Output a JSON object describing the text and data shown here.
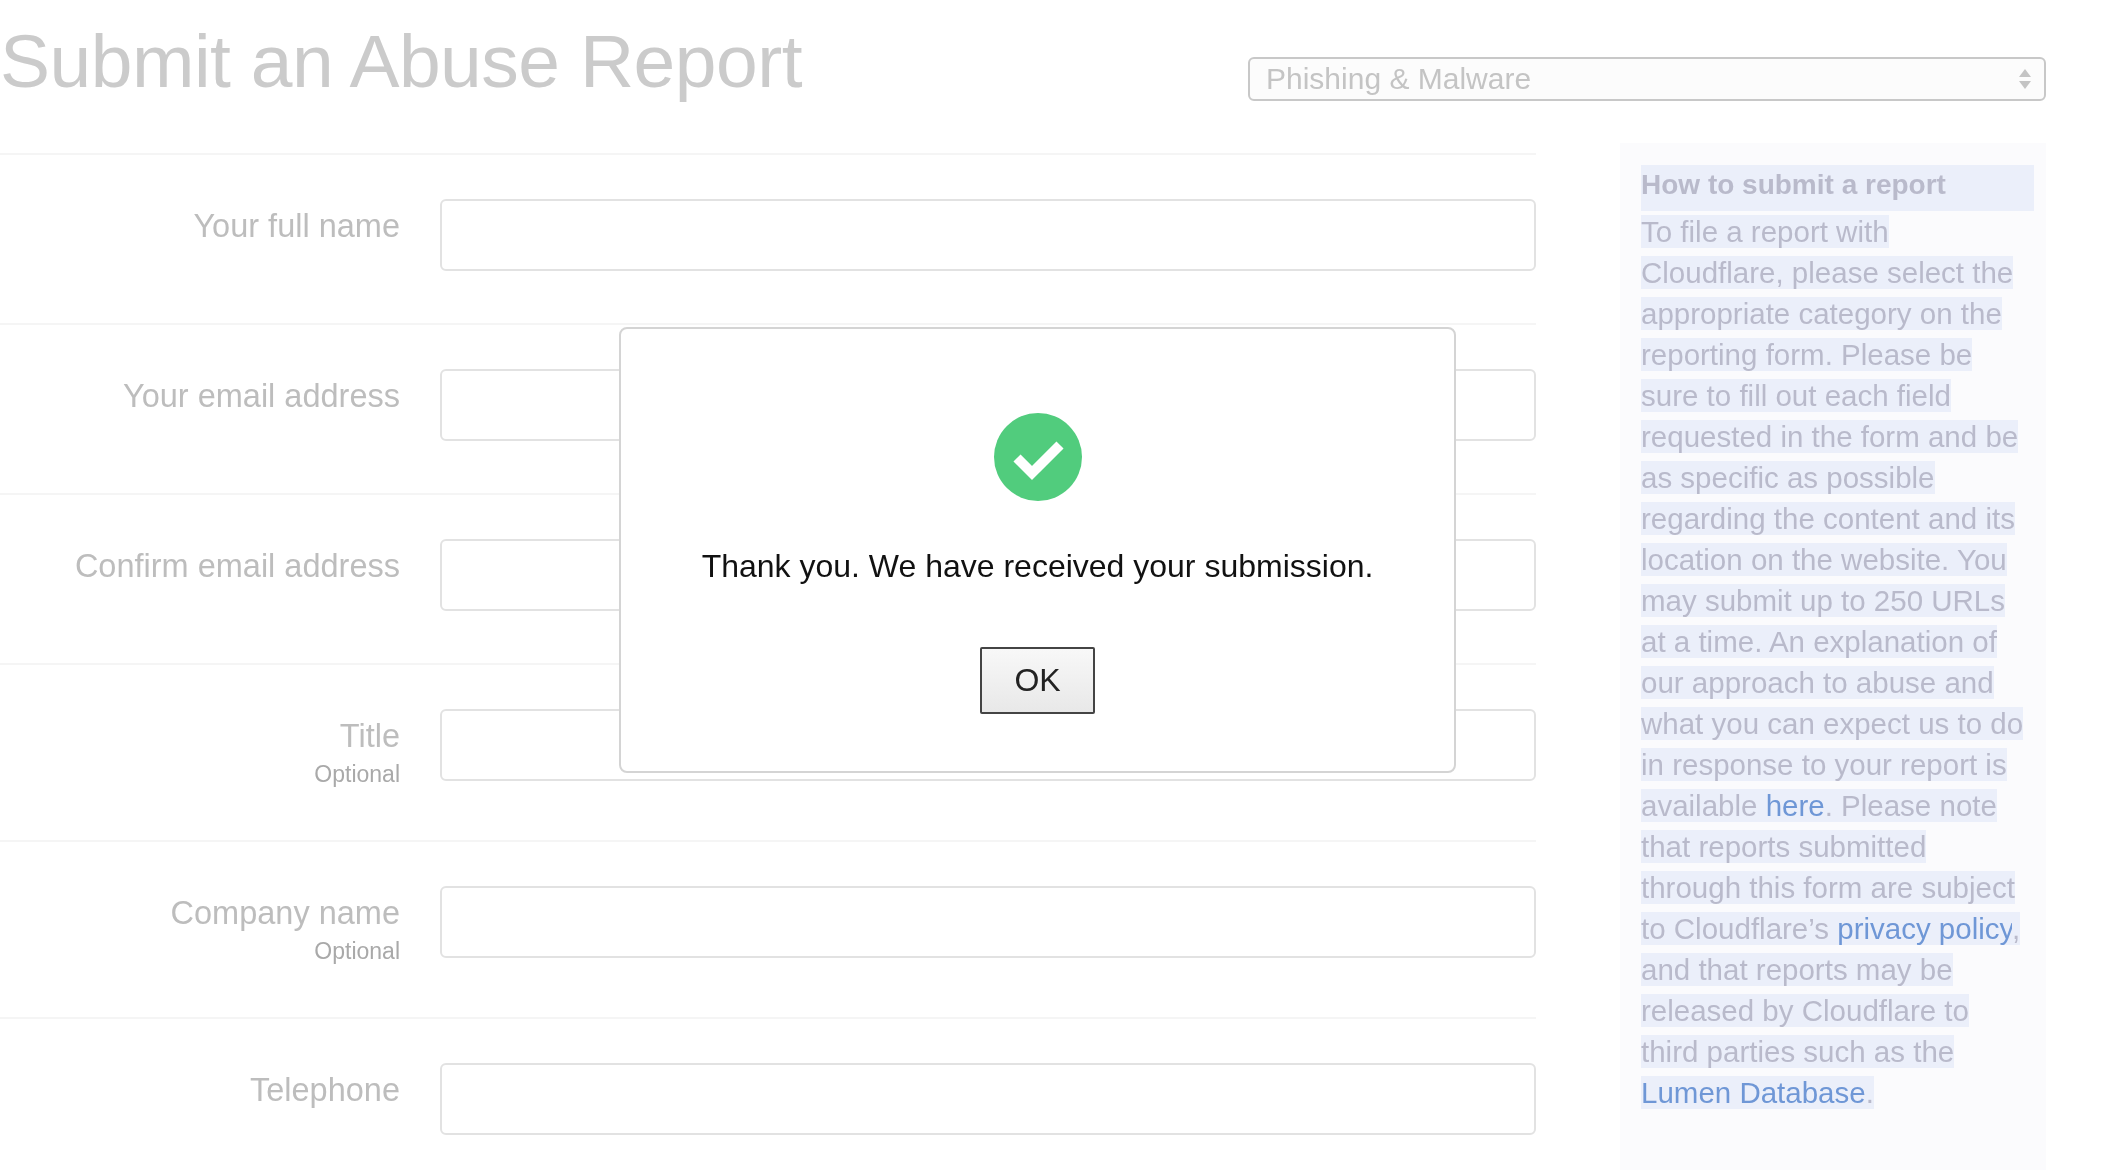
{
  "page": {
    "title": "Submit an Abuse Report",
    "category_select": {
      "value": "Phishing & Malware"
    }
  },
  "form": {
    "fields": [
      {
        "label": "Your full name"
      },
      {
        "label": "Your email address"
      },
      {
        "label": "Confirm email address"
      },
      {
        "label": "Title",
        "hint": "Optional"
      },
      {
        "label": "Company name",
        "hint": "Optional"
      },
      {
        "label": "Telephone"
      }
    ]
  },
  "help_panel": {
    "heading": "How to submit a report",
    "parts": [
      {
        "kind": "text",
        "text": "To file a report with Cloudflare, please select the appropriate category on the reporting form. Please be sure to fill out each field requested in the form and be as specific as possible regarding the content and its location on the website. You may submit up to 250 URLs at a time. An explanation of our approach to abuse and what you can expect us to do in response to your report is available "
      },
      {
        "kind": "link",
        "text": "here"
      },
      {
        "kind": "text",
        "text": ". Please note that reports submitted through this form are subject to Cloudflare’s "
      },
      {
        "kind": "link",
        "text": "privacy policy"
      },
      {
        "kind": "text",
        "text": ", and that reports may be released by Cloudflare to third parties such as the "
      },
      {
        "kind": "link",
        "text": "Lumen Database"
      },
      {
        "kind": "text",
        "text": "."
      }
    ]
  },
  "dialog": {
    "message": "Thank you. We have received your submission.",
    "button": "OK"
  }
}
